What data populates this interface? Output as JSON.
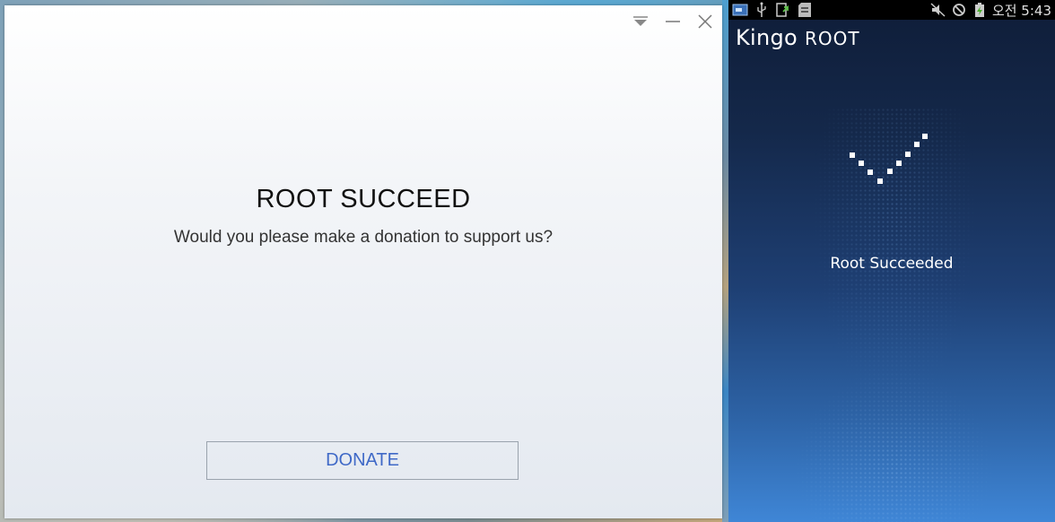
{
  "dialog": {
    "title": "ROOT SUCCEED",
    "subtitle": "Would you please make a donation to support us?",
    "donate_label": "DONATE",
    "controls": {
      "menu_icon": "dropdown-triangle-icon",
      "minimize_icon": "minimize-icon",
      "close_icon": "close-icon"
    }
  },
  "phone": {
    "status_bar": {
      "left_icons": [
        "screenshot-icon",
        "usb-icon",
        "upload-icon",
        "sd-card-icon"
      ],
      "right_icons": [
        "mute-icon",
        "no-sign-icon",
        "battery-charging-icon"
      ],
      "time": "오전 5:43"
    },
    "app_title_main": "Kingo",
    "app_title_sub": "ROOT",
    "status_text": "Root Succeeded",
    "check_icon": "checkmark-dots-icon"
  },
  "colors": {
    "donate_text": "#3f69c7",
    "phone_bg_top": "#0f1d38",
    "phone_bg_bottom": "#3f86d6"
  }
}
